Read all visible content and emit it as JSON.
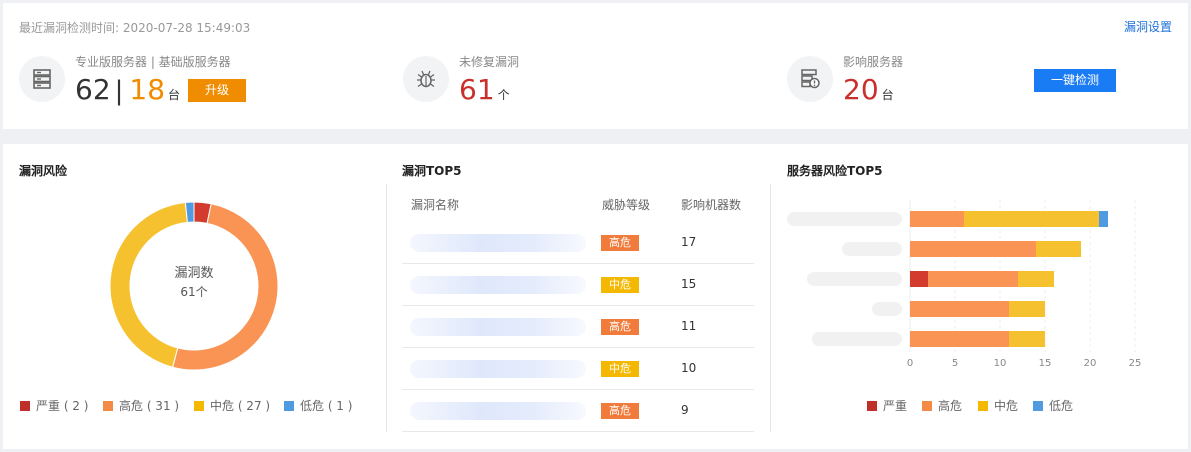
{
  "header": {
    "last_check": "最近漏洞检测时间: 2020-07-28 15:49:03",
    "settings_link": "漏洞设置",
    "scan_button": "一键检测"
  },
  "stats": {
    "servers": {
      "label": "专业版服务器 | 基础版服务器",
      "pro": "62",
      "separator": "|",
      "basic": "18",
      "unit": "台",
      "upgrade": "升级",
      "icon": "server-icon"
    },
    "unfixed": {
      "label": "未修复漏洞",
      "value": "61",
      "unit": "个",
      "icon": "bug-icon"
    },
    "affected": {
      "label": "影响服务器",
      "value": "20",
      "unit": "台",
      "icon": "server-alert-icon"
    }
  },
  "risk": {
    "title": "漏洞风险",
    "center_label": "漏洞数",
    "center_value": "61个",
    "legend": [
      {
        "label": "严重 ( 2 )",
        "color": "#d23b2e",
        "value": 2
      },
      {
        "label": "高危 ( 31 )",
        "color": "#f99454",
        "value": 31
      },
      {
        "label": "中危 ( 27 )",
        "color": "#f5c12e",
        "value": 27
      },
      {
        "label": "低危 ( 1 )",
        "color": "#4f9ae0",
        "value": 1
      }
    ]
  },
  "top5": {
    "title": "漏洞TOP5",
    "headers": [
      "漏洞名称",
      "威胁等级",
      "影响机器数"
    ],
    "rows": [
      {
        "level": "高危",
        "color": "#f07b3a",
        "count": "17"
      },
      {
        "level": "中危",
        "color": "#f5b800",
        "count": "15"
      },
      {
        "level": "高危",
        "color": "#f07b3a",
        "count": "11"
      },
      {
        "level": "中危",
        "color": "#f5b800",
        "count": "10"
      },
      {
        "level": "高危",
        "color": "#f07b3a",
        "count": "9"
      }
    ]
  },
  "server_top5": {
    "title": "服务器风险TOP5",
    "legend": [
      {
        "label": "严重",
        "color": "#d23b2e"
      },
      {
        "label": "高危",
        "color": "#f99454"
      },
      {
        "label": "中危",
        "color": "#f5c12e"
      },
      {
        "label": "低危",
        "color": "#4f9ae0"
      }
    ]
  },
  "chart_data": {
    "type": "bar",
    "orientation": "horizontal",
    "stacked": true,
    "xlim": [
      0,
      25
    ],
    "xticks": [
      "0",
      "5",
      "10",
      "15",
      "20",
      "25"
    ],
    "grid": true,
    "legend_position": "bottom",
    "categories": [
      "",
      "",
      "",
      "",
      ""
    ],
    "series": [
      {
        "name": "严重",
        "color": "#d23b2e",
        "values": [
          0,
          0,
          2,
          0,
          0
        ]
      },
      {
        "name": "高危",
        "color": "#f99454",
        "values": [
          6,
          14,
          10,
          11,
          11
        ]
      },
      {
        "name": "中危",
        "color": "#f5c12e",
        "values": [
          15,
          5,
          4,
          4,
          4
        ]
      },
      {
        "name": "低危",
        "color": "#4f9ae0",
        "values": [
          1,
          0,
          0,
          0,
          0
        ]
      }
    ]
  }
}
